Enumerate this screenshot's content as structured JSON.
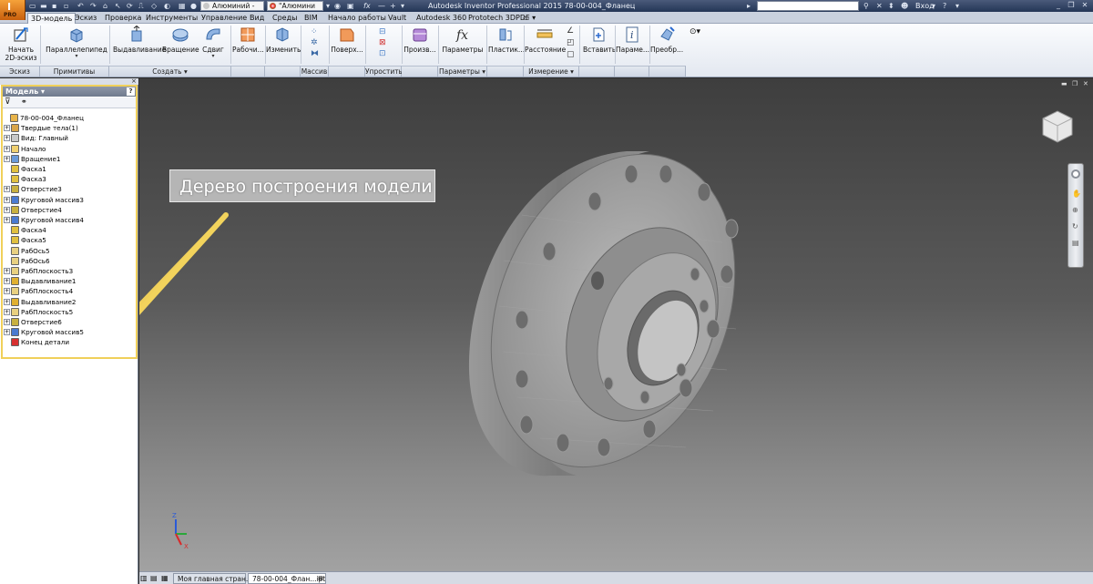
{
  "titlebar": {
    "logo_text": "I",
    "logo_sub": "PRO",
    "material_combo": "Алюминий -",
    "appearance_combo": "\"Алюмини",
    "fx_label": "fx",
    "window_title": "Autodesk Inventor Professional 2015   78-00-004_Фланец",
    "search_placeholder": "",
    "login": "Вход"
  },
  "tabs": [
    "3D-модель",
    "Эскиз",
    "Проверка",
    "Инструменты",
    "Управление",
    "Вид",
    "Среды",
    "BIM",
    "Начало работы",
    "Vault",
    "Autodesk 360",
    "Prototech 3DPDF"
  ],
  "ribbon": {
    "buttons": {
      "sketch": "Начать\n2D-эскиз",
      "box": "Параллелепипед",
      "extrude": "Выдавливание",
      "revolve": "Вращение",
      "sweep": "Сдвиг",
      "work": "Рабочи...",
      "modify": "Изменить",
      "surface": "Поверх...",
      "derive": "Произв...",
      "params": "Параметры",
      "plastic": "Пластик...",
      "distance": "Расстояние",
      "insert": "Вставить",
      "param2": "Параме...",
      "convert": "Преобр..."
    },
    "panels": {
      "sketch": "Эскиз",
      "primitives": "Примитивы",
      "create": "Создать",
      "pattern": "Массив",
      "simplify": "Упростить",
      "parameters": "Параметры",
      "measure": "Измерение"
    }
  },
  "browser": {
    "title": "Модель",
    "help": "?",
    "close": "×",
    "items": [
      {
        "label": "78-00-004_Фланец",
        "exp": false,
        "color": "#e8b44a"
      },
      {
        "label": "Твердые тела(1)",
        "exp": true,
        "color": "#d9a54a"
      },
      {
        "label": "Вид: Главный",
        "exp": true,
        "color": "#c8c8c8"
      },
      {
        "label": "Начало",
        "exp": true,
        "color": "#f0d070"
      },
      {
        "label": "Вращение1",
        "exp": true,
        "color": "#6a9ad8"
      },
      {
        "label": "Фаска1",
        "exp": false,
        "color": "#e0c040"
      },
      {
        "label": "Фаска3",
        "exp": false,
        "color": "#e0c040"
      },
      {
        "label": "Отверстие3",
        "exp": true,
        "color": "#c8b040"
      },
      {
        "label": "Круговой массив3",
        "exp": true,
        "color": "#4a7ad0"
      },
      {
        "label": "Отверстие4",
        "exp": true,
        "color": "#c8b040"
      },
      {
        "label": "Круговой массив4",
        "exp": true,
        "color": "#4a7ad0"
      },
      {
        "label": "Фаска4",
        "exp": false,
        "color": "#e0c040"
      },
      {
        "label": "Фаска5",
        "exp": false,
        "color": "#e0c040"
      },
      {
        "label": "РабОсь5",
        "exp": false,
        "color": "#e8d080"
      },
      {
        "label": "РабОсь6",
        "exp": false,
        "color": "#e8d080"
      },
      {
        "label": "РабПлоскость3",
        "exp": true,
        "color": "#e8d080"
      },
      {
        "label": "Выдавливание1",
        "exp": true,
        "color": "#e0b030"
      },
      {
        "label": "РабПлоскость4",
        "exp": true,
        "color": "#e8d080"
      },
      {
        "label": "Выдавливание2",
        "exp": true,
        "color": "#e0b030"
      },
      {
        "label": "РабПлоскость5",
        "exp": true,
        "color": "#e8d080"
      },
      {
        "label": "Отверстие6",
        "exp": true,
        "color": "#c8b040"
      },
      {
        "label": "Круговой массив5",
        "exp": true,
        "color": "#4a7ad0"
      },
      {
        "label": "Конец детали",
        "exp": false,
        "color": "#d83030"
      }
    ]
  },
  "viewport": {
    "callout": "Дерево построения модели",
    "accent": "#f0d05a"
  },
  "doctabs": [
    "Моя главная стран...",
    "78-00-004_Флан...ipt"
  ]
}
